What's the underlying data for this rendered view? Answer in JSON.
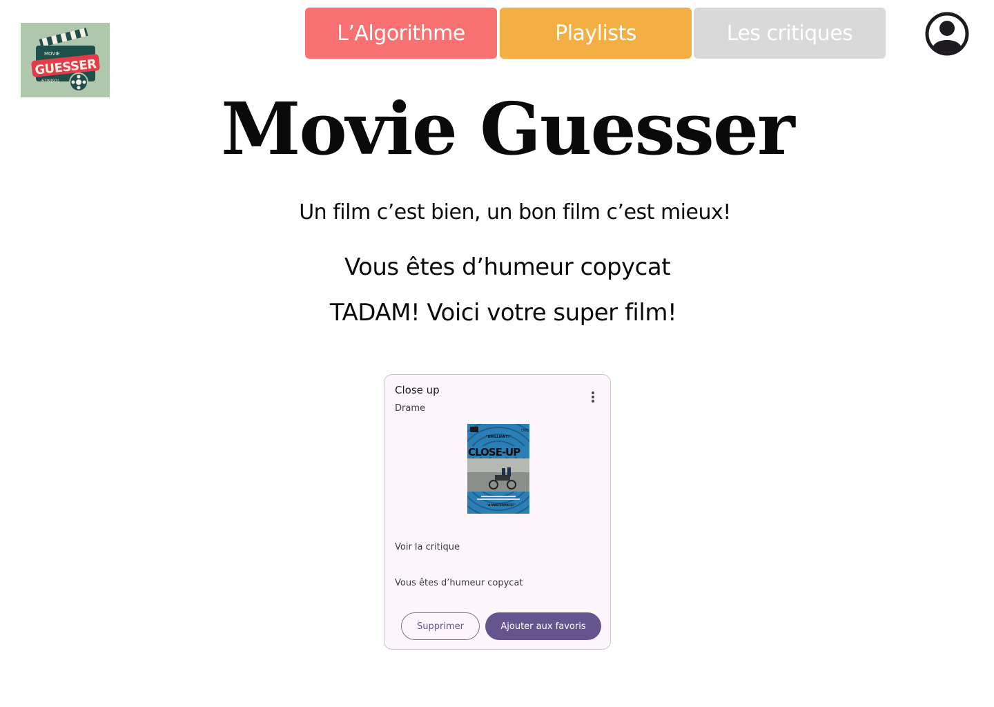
{
  "logo": {
    "top_text": "MOVIE",
    "main_text": "GUESSER",
    "strip_text": "67|9|97|"
  },
  "nav": {
    "algorithm": "L’Algorithme",
    "playlists": "Playlists",
    "critiques": "Les critiques"
  },
  "icons": {
    "account": "account-circle-icon",
    "menu": "more-vert-icon"
  },
  "main": {
    "title": "Movie Guesser",
    "tagline": "Un film c’est bien, un bon film c’est mieux!",
    "mood": "Vous êtes d’humeur copycat",
    "result": "TADAM! Voici votre super film!"
  },
  "card": {
    "title": "Close up",
    "genre": "Drame",
    "poster": {
      "title": "CLOSE-UP",
      "quote_top": "\"BRILLIANT!\"",
      "quote_bottom": "\"A MASTERPIECE!\"",
      "label": "DVD"
    },
    "link": "Voir la critique",
    "mood": "Vous êtes d’humeur copycat",
    "delete_label": "Supprimer",
    "favorite_label": "Ajouter aux favoris"
  },
  "colors": {
    "algorithm_bg": "#f87274",
    "playlists_bg": "#f3ae44",
    "critiques_bg": "#d9d9d9",
    "primary": "#65558f",
    "card_bg": "#fdf6fd",
    "logo_bg": "#aec7ad"
  }
}
